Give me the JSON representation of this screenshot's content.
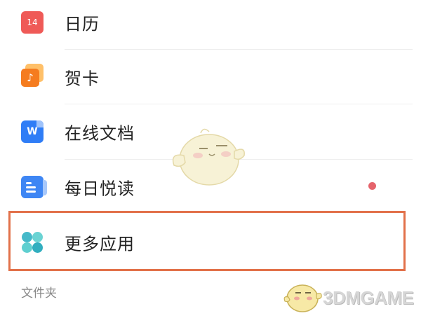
{
  "apps": [
    {
      "label": "日历",
      "icon": "calendar-icon",
      "icon_text": "14",
      "color": "#ef5a57"
    },
    {
      "label": "贺卡",
      "icon": "greeting-card-icon",
      "icon_text": "♪",
      "color": "#f57c1f"
    },
    {
      "label": "在线文档",
      "icon": "online-docs-icon",
      "icon_text": "W",
      "color": "#2f7df6"
    },
    {
      "label": "每日悦读",
      "icon": "daily-read-icon",
      "color": "#3e86f4",
      "has_unread_dot": true
    },
    {
      "label": "更多应用",
      "icon": "more-apps-icon",
      "color": "#3cc3c5",
      "highlighted": true
    }
  ],
  "section": {
    "label": "文件夹"
  },
  "highlight_color": "#e2714a",
  "unread_dot_color": "#e5636b",
  "watermark": {
    "text": "3DMGAME"
  }
}
